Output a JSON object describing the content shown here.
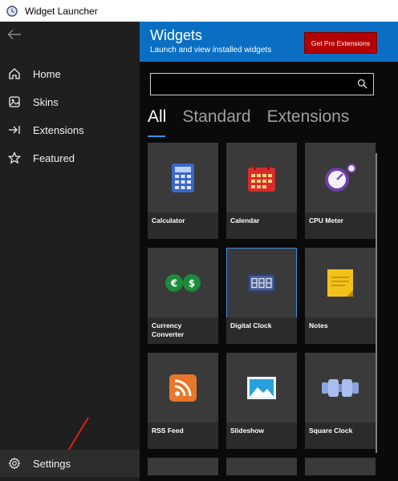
{
  "window": {
    "title": "Widget Launcher"
  },
  "sidebar": {
    "items": [
      {
        "label": "Home",
        "icon": "home-icon"
      },
      {
        "label": "Skins",
        "icon": "skins-icon"
      },
      {
        "label": "Extensions",
        "icon": "extensions-icon"
      },
      {
        "label": "Featured",
        "icon": "star-icon"
      }
    ],
    "settings": {
      "label": "Settings",
      "icon": "gear-icon"
    }
  },
  "header": {
    "title": "Widgets",
    "subtitle": "Launch and view installed widgets",
    "pro_button": "Get Pro Extensions"
  },
  "search": {
    "value": "",
    "placeholder": ""
  },
  "tabs": [
    {
      "label": "All",
      "active": true
    },
    {
      "label": "Standard",
      "active": false
    },
    {
      "label": "Extensions",
      "active": false
    }
  ],
  "widgets": [
    {
      "label": "Calculator",
      "icon": "calculator-icon"
    },
    {
      "label": "Calendar",
      "icon": "calendar-icon"
    },
    {
      "label": "CPU Meter",
      "icon": "cpu-meter-icon"
    },
    {
      "label": "Currency Converter",
      "icon": "currency-icon"
    },
    {
      "label": "Digital Clock",
      "icon": "digital-clock-icon",
      "selected": true
    },
    {
      "label": "Notes",
      "icon": "notes-icon"
    },
    {
      "label": "RSS Feed",
      "icon": "rss-icon"
    },
    {
      "label": "Slideshow",
      "icon": "slideshow-icon"
    },
    {
      "label": "Square Clock",
      "icon": "square-clock-icon"
    }
  ],
  "colors": {
    "header_blue": "#0a6fc2",
    "pro_red": "#b30000",
    "sidebar_bg": "#1f1f1f",
    "tile_bg": "#3a3a3a",
    "annotation_arrow": "#e01f1f"
  }
}
